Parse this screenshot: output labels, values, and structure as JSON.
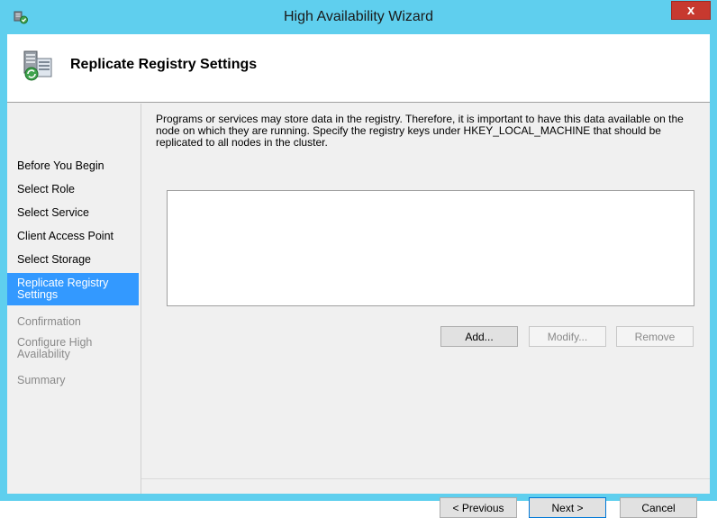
{
  "window": {
    "title": "High Availability Wizard",
    "close_glyph": "x"
  },
  "header": {
    "title": "Replicate Registry Settings"
  },
  "sidebar": {
    "items": [
      {
        "label": "Before You Begin",
        "state": "normal"
      },
      {
        "label": "Select Role",
        "state": "normal"
      },
      {
        "label": "Select Service",
        "state": "normal"
      },
      {
        "label": "Client Access Point",
        "state": "normal"
      },
      {
        "label": "Select Storage",
        "state": "normal"
      },
      {
        "label": "Replicate Registry Settings",
        "state": "active"
      },
      {
        "label": "Confirmation",
        "state": "disabled"
      },
      {
        "label": "Configure High Availability",
        "state": "disabled"
      },
      {
        "label": "Summary",
        "state": "disabled"
      }
    ]
  },
  "main": {
    "description": "Programs or services may store data in the registry.  Therefore, it is important to have this data available on the node on which they are running.  Specify the registry keys under HKEY_LOCAL_MACHINE that should be replicated to all nodes in the cluster.",
    "registry_keys": [],
    "buttons": {
      "add": "Add...",
      "modify": "Modify...",
      "remove": "Remove"
    }
  },
  "footer": {
    "previous": "< Previous",
    "next": "Next >",
    "cancel": "Cancel"
  },
  "colors": {
    "title_bar": "#5fcfee",
    "close_button": "#c7392f",
    "selected_nav": "#3399ff",
    "default_button_border": "#0078d7"
  },
  "icons": {
    "title": "cluster-wizard-icon",
    "header": "server-registry-icon"
  }
}
